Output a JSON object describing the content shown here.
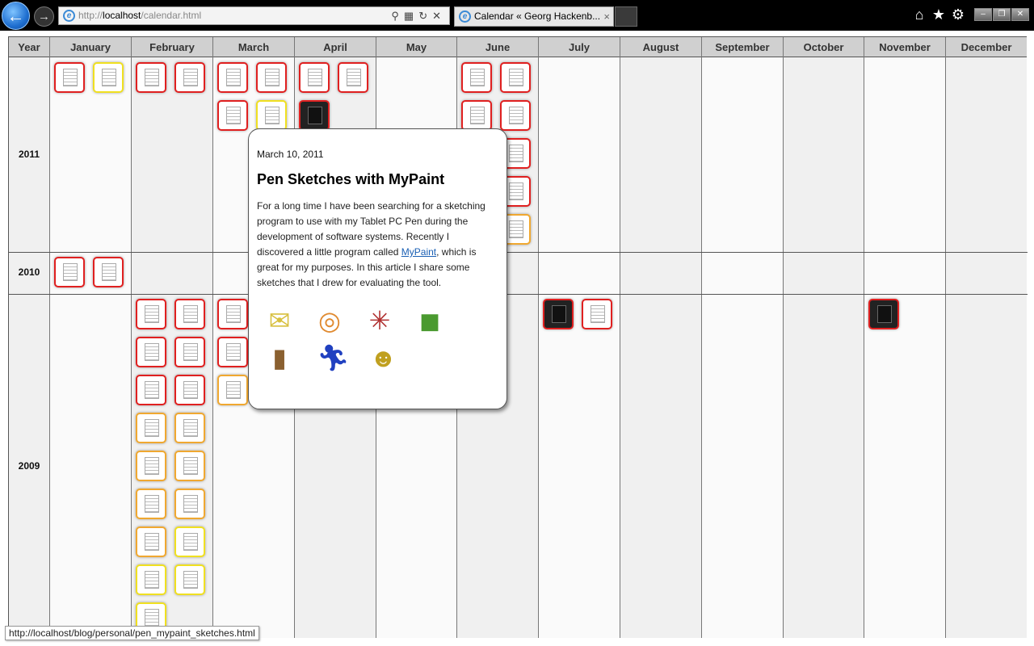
{
  "browser": {
    "back_glyph": "←",
    "forward_glyph": "→",
    "address": {
      "scheme": "http://",
      "host": "localhost",
      "path": "/calendar.html"
    },
    "tab_title": "Calendar « Georg Hackenb...",
    "tab_close": "×",
    "right_icons": [
      "home-icon",
      "star-icon",
      "gear-icon"
    ],
    "window_buttons": [
      "minimize",
      "restore",
      "close"
    ]
  },
  "calendar": {
    "year_header": "Year",
    "months": [
      "January",
      "February",
      "March",
      "April",
      "May",
      "June",
      "July",
      "August",
      "September",
      "October",
      "November",
      "December"
    ],
    "years": [
      "2011",
      "2010",
      "2009"
    ]
  },
  "popup": {
    "date": "March 10, 2011",
    "title": "Pen Sketches with MyPaint",
    "body_before": "For a long time I have been searching for a sketching program to use with my Tablet PC Pen during the development of software systems. Recently I discovered a little program called ",
    "link_text": "MyPaint",
    "body_after": ", which is great for my purposes. In this article I share some sketches that I drew for evaluating the tool.",
    "icons": [
      "envelope-icon",
      "rss-icon",
      "sparkle-icon",
      "bucket-icon",
      "book-icon",
      "runner-icon",
      "face-icon"
    ]
  },
  "status_bar": "http://localhost/blog/personal/pen_mypaint_sketches.html"
}
